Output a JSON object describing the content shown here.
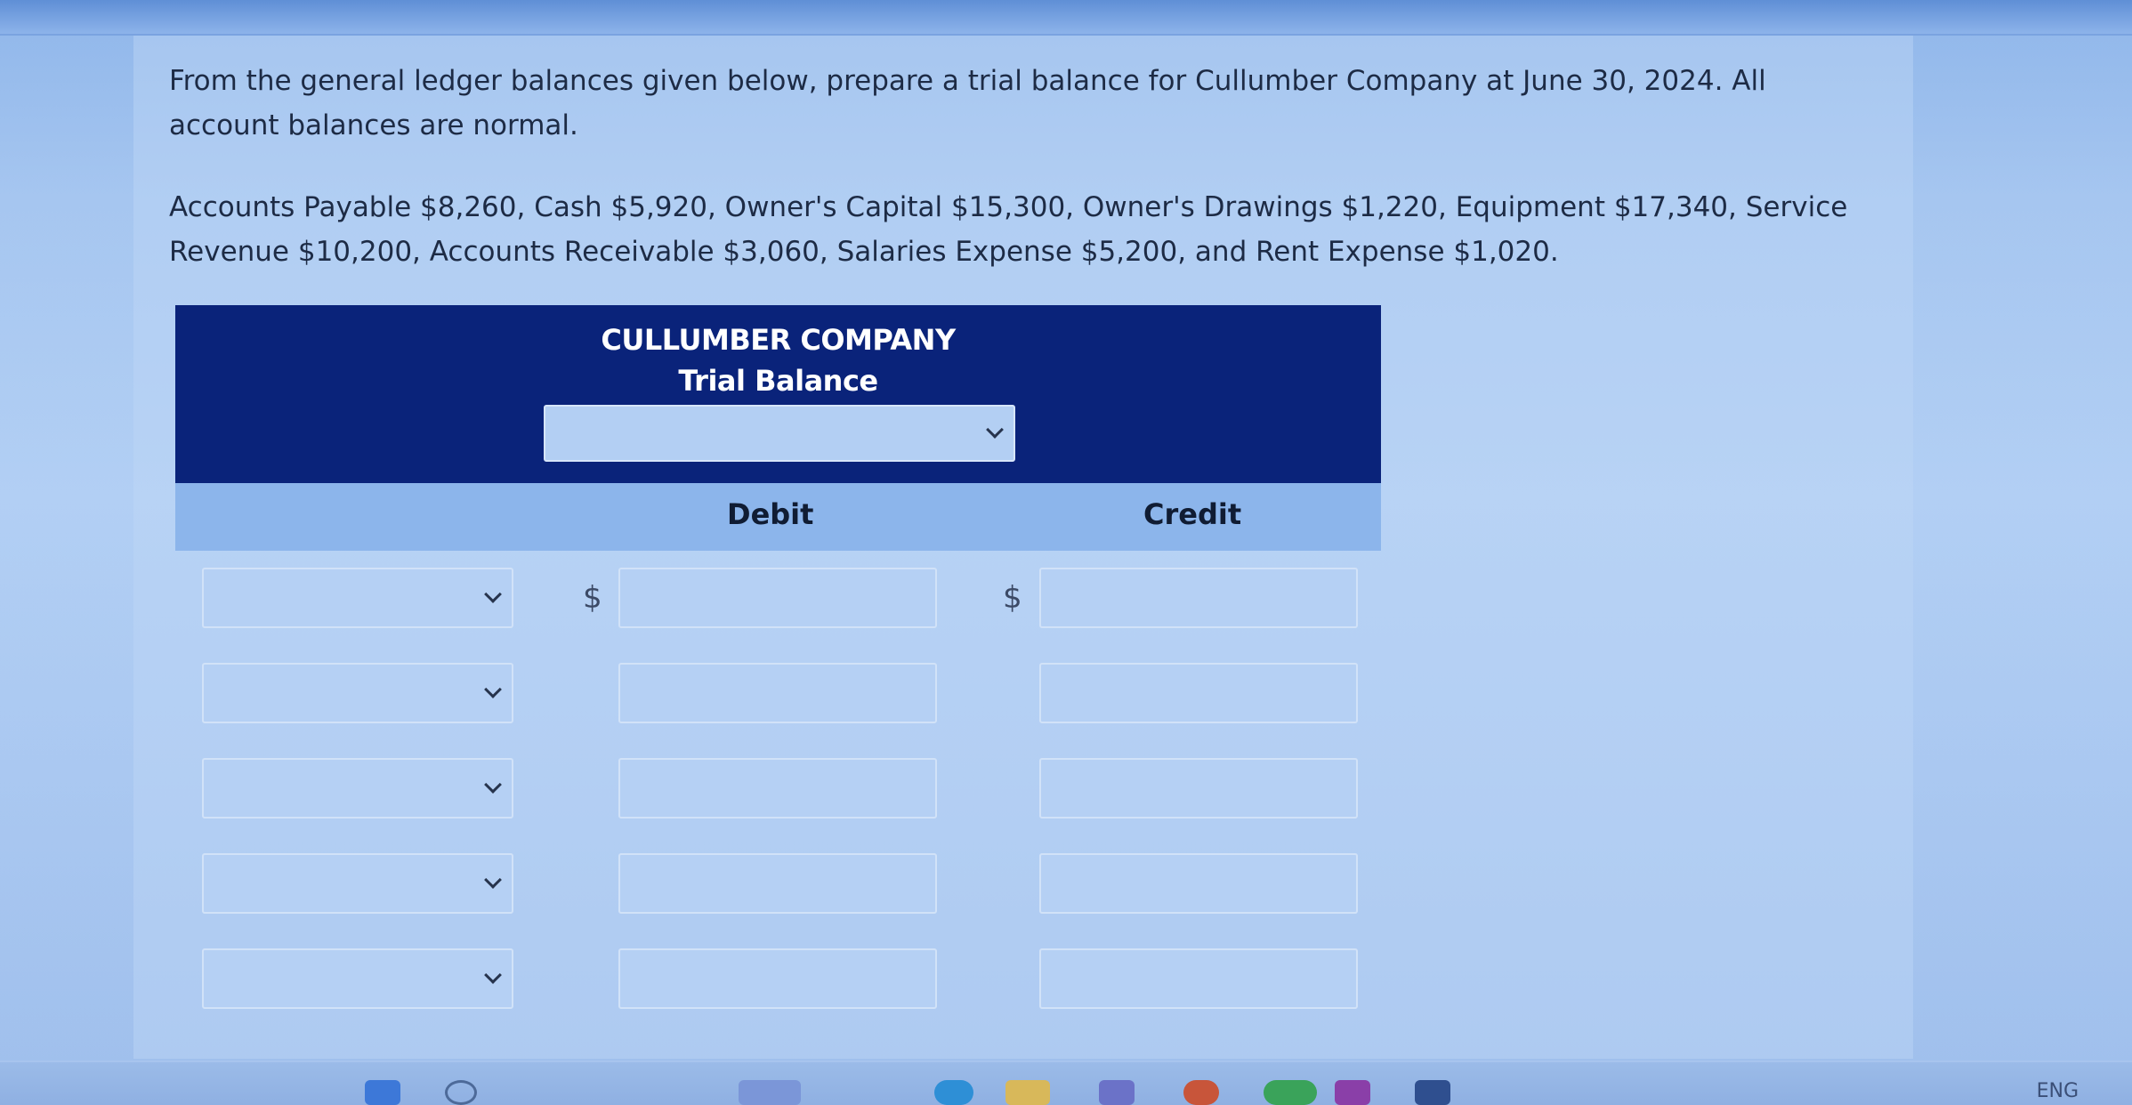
{
  "question": {
    "line1": "From the general ledger balances given below, prepare a trial balance for Cullumber Company at June 30, 2024. All account balances are normal.",
    "line2": "Accounts Payable $8,260, Cash $5,920, Owner's Capital $15,300, Owner's Drawings $1,220, Equipment $17,340, Service Revenue $10,200, Accounts Receivable $3,060, Salaries Expense $5,200, and Rent Expense $1,020."
  },
  "trial_balance": {
    "company": "CULLUMBER COMPANY",
    "title": "Trial Balance",
    "date_select_value": "",
    "columns": {
      "debit": "Debit",
      "credit": "Credit"
    },
    "currency_symbol": "$",
    "rows": [
      {
        "account": "",
        "debit": "",
        "credit": ""
      },
      {
        "account": "",
        "debit": "",
        "credit": ""
      },
      {
        "account": "",
        "debit": "",
        "credit": ""
      },
      {
        "account": "",
        "debit": "",
        "credit": ""
      },
      {
        "account": "",
        "debit": "",
        "credit": ""
      }
    ]
  },
  "taskbar": {
    "language": "ENG",
    "icons": [
      "windows-start-icon",
      "search-icon",
      "widgets-icon",
      "file-explorer-icon",
      "teams-icon",
      "chrome-icon",
      "edge-icon",
      "mail-icon",
      "store-icon",
      "calendar-icon"
    ]
  }
}
